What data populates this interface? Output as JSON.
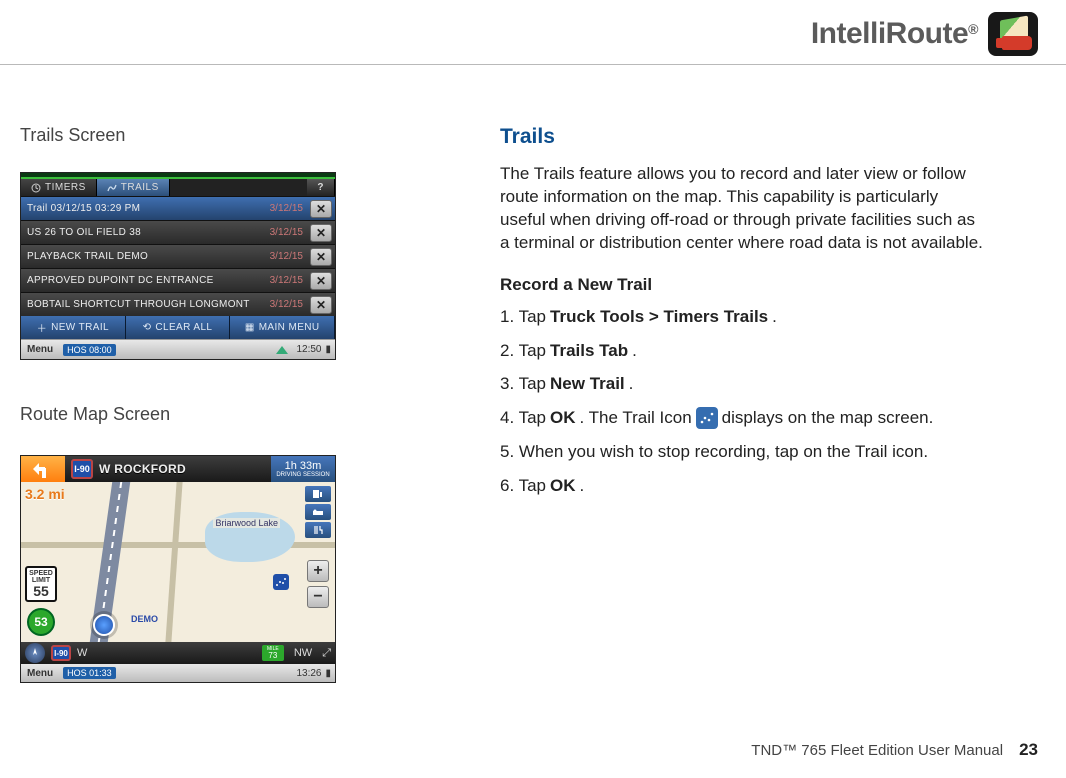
{
  "header": {
    "brand": "IntelliRoute",
    "reg": "®"
  },
  "left": {
    "caption_trails": "Trails Screen",
    "caption_map": "Route Map Screen"
  },
  "trails_screen": {
    "tab_timers": "TIMERS",
    "tab_trails": "TRAILS",
    "help": "?",
    "rows": [
      {
        "label": "Trail 03/12/15 03:29 PM",
        "date": "3/12/15"
      },
      {
        "label": "US 26 TO OIL FIELD 38",
        "date": "3/12/15"
      },
      {
        "label": "PLAYBACK TRAIL DEMO",
        "date": "3/12/15"
      },
      {
        "label": "APPROVED DUPOINT DC ENTRANCE",
        "date": "3/12/15"
      },
      {
        "label": "BOBTAIL SHORTCUT THROUGH LONGMONT",
        "date": "3/12/15"
      }
    ],
    "btn_new": "NEW TRAIL",
    "btn_clear": "CLEAR ALL",
    "btn_main": "MAIN MENU",
    "menu": "Menu",
    "hos": "HOS",
    "hos_time": "08:00",
    "clock": "12:50"
  },
  "map_screen": {
    "shield": "I-90",
    "name": "W   ROCKFORD",
    "eta": "1h 33m",
    "eta_sub": "DRIVING SESSION",
    "distance": "3.2 mi",
    "lake": "Briarwood Lake",
    "speed_limit_label": "SPEED\nLIMIT",
    "speed_limit": "55",
    "cur_speed": "53",
    "demo": "DEMO",
    "zoom_in": "+",
    "zoom_out": "−",
    "foot_shield": "I-90",
    "foot_name": "W",
    "mile_lbl": "MILE",
    "mile_val": "73",
    "heading": "NW",
    "menu": "Menu",
    "hos": "HOS",
    "hos_time": "01:33",
    "clock": "13:26"
  },
  "right": {
    "title": "Trails",
    "para": "The Trails feature allows you to record and later view or follow route information on the map. This capability is particularly useful when driving off-road or through private facilities such as a terminal or distribution center where road data is not available.",
    "subhead": "Record a New Trail",
    "steps": {
      "s1a": "1. Tap ",
      "s1b": "Truck Tools > Timers Trails",
      "s1c": ".",
      "s2a": "2. Tap ",
      "s2b": "Trails Tab",
      "s2c": ".",
      "s3a": "3. Tap ",
      "s3b": "New Trail",
      "s3c": ".",
      "s4a": "4. Tap ",
      "s4b": "OK",
      "s4c": ". The Trail Icon ",
      "s4d": " displays on the map screen.",
      "s5": "5. When you wish to stop recording, tap on the Trail icon.",
      "s6a": "6. Tap ",
      "s6b": "OK",
      "s6c": "."
    }
  },
  "footer": {
    "text": "TND™ 765 Fleet Edition User Manual",
    "page": "23"
  }
}
